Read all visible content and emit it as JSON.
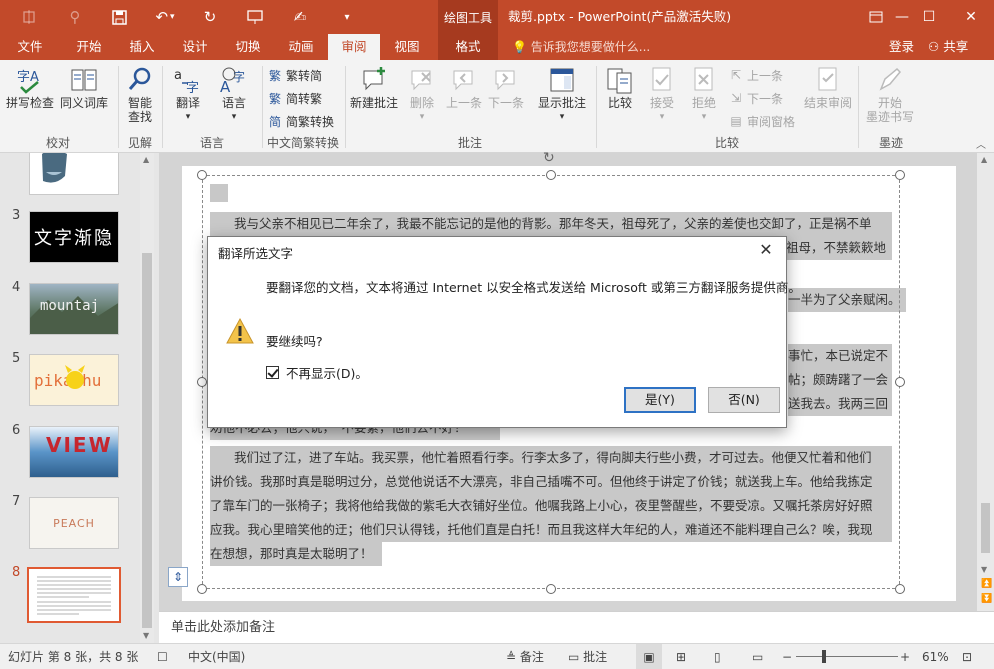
{
  "titlebar": {
    "contextual_tab": "绘图工具",
    "document_title": "裁剪.pptx - PowerPoint(产品激活失败)"
  },
  "tabs": {
    "file": "文件",
    "home": "开始",
    "insert": "插入",
    "design": "设计",
    "transitions": "切换",
    "animations": "动画",
    "review": "审阅",
    "view": "视图",
    "format": "格式",
    "tell_me": "告诉我您想要做什么...",
    "login": "登录",
    "share": "共享"
  },
  "ribbon": {
    "proofing": {
      "label": "校对",
      "spelling": "拼写检查",
      "thesaurus": "同义词库"
    },
    "insights": {
      "label": "见解",
      "smart_lookup_1": "智能",
      "smart_lookup_2": "查找"
    },
    "language": {
      "label": "语言",
      "translate": "翻译",
      "language": "语言"
    },
    "chinese_conversion": {
      "label": "中文简繁转换",
      "to_traditional": "繁转简",
      "to_simplified": "简转繁",
      "convert": "简繁转换"
    },
    "comments": {
      "label": "批注",
      "new": "新建批注",
      "delete": "删除",
      "previous": "上一条",
      "next": "下一条",
      "show": "显示批注"
    },
    "compare": {
      "label": "比较",
      "compare": "比较",
      "accept": "接受",
      "reject": "拒绝",
      "previous": "上一条",
      "next": "下一条",
      "reviewing_pane": "审阅窗格",
      "end_review": "结束审阅"
    },
    "ink": {
      "label": "墨迹",
      "start_inking_1": "开始",
      "start_inking_2": "墨迹书写"
    }
  },
  "thumbnails": {
    "numbers": [
      "3",
      "4",
      "5",
      "6",
      "7",
      "8"
    ],
    "texts": {
      "s3": "文字渐隐",
      "s4": "mountaj",
      "s5": "pikachu",
      "s6": "VIEW",
      "s7": "PEACH"
    }
  },
  "slide": {
    "lines": [
      "我与父亲不相见已二年余了，我最不能忘记的是他的背影。那年冬天，祖母死了，父亲的差使也交卸了，正是祸不单",
      "祖母，不禁簌簌地",
      "一半为了父亲赋闲。",
      "事忙，本已说定不",
      "帖；颇踌躇了一会",
      "送我去。我两三回",
      "劝他不必去；他只说，“不要紧，他们去不好！",
      "我们过了江，进了车站。我买票，他忙着照看行李。行李太多了，得向脚夫行些小费，才可过去。他便又忙着和他们",
      "讲价钱。我那时真是聪明过分，总觉他说话不大漂亮，非自己插嘴不可。但他终于讲定了价钱；就送我上车。他给我拣定",
      "了靠车门的一张椅子；我将他给我做的紫毛大衣铺好坐位。他嘱我路上小心，夜里警醒些，不要受凉。又嘱托茶房好好照",
      "应我。我心里暗笑他的迂；他们只认得钱，托他们直是白托！而且我这样大年纪的人，难道还不能料理自己么？唉，我现",
      "在想想，那时真是太聪明了！"
    ]
  },
  "notes_placeholder": "单击此处添加备注",
  "status": {
    "slide_info": "幻灯片 第 8 张，共 8 张",
    "language": "中文(中国)",
    "notes": "备注",
    "comments": "批注",
    "zoom": "61%"
  },
  "dialog": {
    "title": "翻译所选文字",
    "message": "要翻译您的文档，文本将通过 Internet 以安全格式发送给 Microsoft 或第三方翻译服务提供商。",
    "question": "要继续吗?",
    "checkbox_label": "不再显示(D)。",
    "yes": "是(Y)",
    "no": "否(N)"
  },
  "colors": {
    "accent": "#c24a2a",
    "ribbon_bg": "#f3f3f3",
    "selection": "#c8c8c8"
  }
}
